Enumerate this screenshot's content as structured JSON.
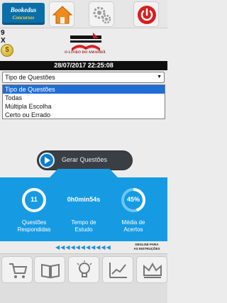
{
  "header": {
    "logo_line1": "Bookedus",
    "logo_line2": "Concursos",
    "buttons": [
      {
        "icon": "home-icon"
      },
      {
        "icon": "gear-icon"
      },
      {
        "icon": "power-icon"
      }
    ]
  },
  "side": {
    "counter": "9",
    "x_label": "X",
    "coin_symbol": "$"
  },
  "brand": {
    "caption": "O LIVRO DO AMANHÃ"
  },
  "datetime": "28/07/2017 22:25:08",
  "question_type": {
    "selected": "Tipo de Questões",
    "options": [
      "Tipo de Questões",
      "Todas",
      "Múltipla Escolha",
      "Certo ou Errado"
    ],
    "highlighted_index": 0
  },
  "action": {
    "generate_label": "Gerar Questões"
  },
  "stats": {
    "answered_value": "11",
    "answered_label_line1": "Questões",
    "answered_label_line2": "Respondidas",
    "study_time_value": "0h0min54s",
    "study_time_label_line1": "Tempo de",
    "study_time_label_line2": "Estudo",
    "accuracy_value": "45%",
    "accuracy_fraction": 0.45,
    "accuracy_label_line1": "Média de",
    "accuracy_label_line2": "Acertos"
  },
  "nav": {
    "hint_line1": "DESLISE PARA",
    "hint_line2": "AS INSTRUÇÕES"
  },
  "bottom_toolbar": [
    {
      "icon": "cart-icon"
    },
    {
      "icon": "book-icon"
    },
    {
      "icon": "lightbulb-icon"
    },
    {
      "icon": "chart-icon"
    },
    {
      "icon": "crown-icon"
    }
  ],
  "colors": {
    "accent_blue": "#169be2",
    "logo_blue": "#0a6fa8",
    "selection_blue": "#1e6ed6",
    "home_orange": "#f08a1c",
    "power_red": "#d71f1f"
  }
}
